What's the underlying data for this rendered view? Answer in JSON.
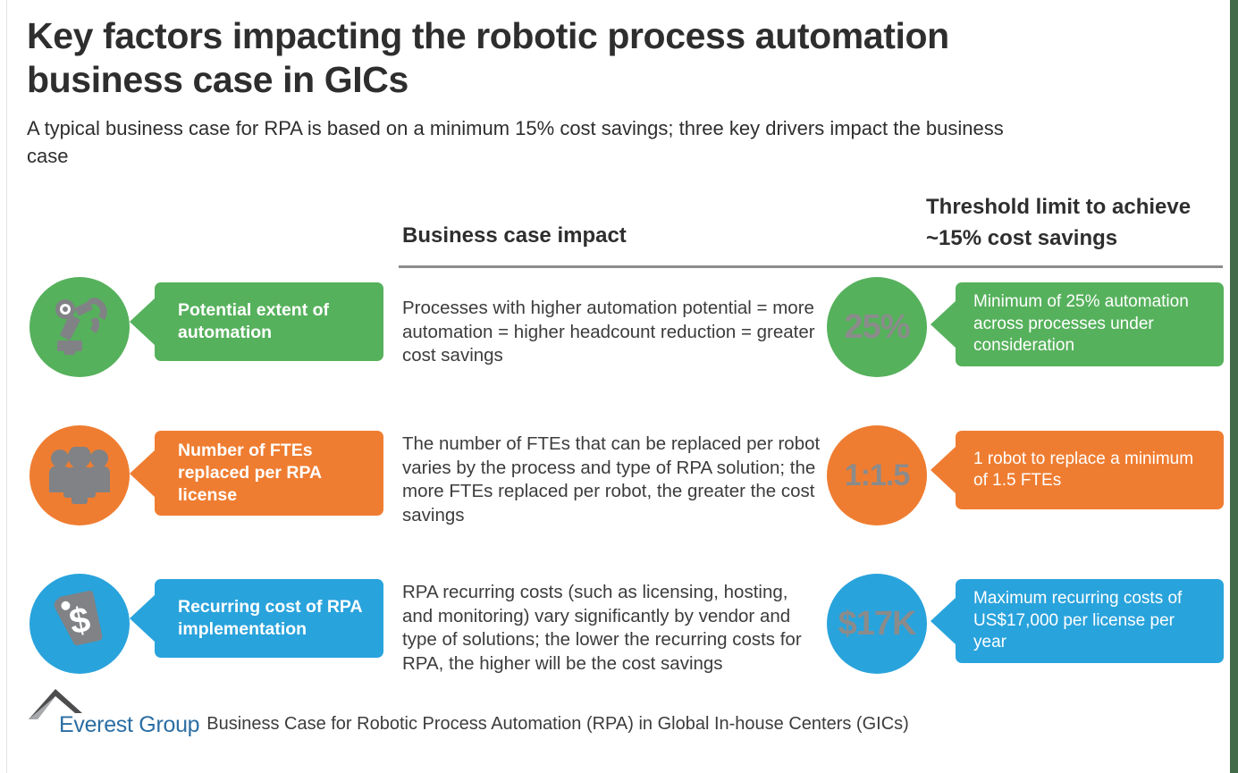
{
  "colors": {
    "green": "#56b15c",
    "orange": "#ef7d31",
    "blue": "#29a3dc",
    "icon_gray": "#808285",
    "value_gray": "#8b8b8b",
    "edge_green": "#426b4a",
    "rule_gray": "#8c8c8c",
    "logo_blue": "#2b6ea3",
    "logo_mark_gray": "#4d4d4f",
    "text_dark": "#2e2e2e"
  },
  "header": {
    "title": "Key factors impacting the robotic process automation business case in GICs",
    "subtitle": "A typical business case for RPA is based on a minimum 15% cost  savings; three key drivers impact the business case"
  },
  "columns": {
    "impact_header": "Business case impact",
    "threshold_header_line1": "Threshold limit to achieve",
    "threshold_header_line2": "~15% cost savings"
  },
  "rows": [
    {
      "color": "#56b15c",
      "icon": "robot-arm-icon",
      "driver_label": "Potential extent of automation",
      "impact_text": "Processes with higher automation potential = more automation = higher headcount reduction = greater cost savings",
      "value": "25%",
      "threshold_text": "Minimum of 25% automation across processes under consideration"
    },
    {
      "color": "#ef7d31",
      "icon": "people-group-icon",
      "driver_label": "Number of FTEs replaced per RPA license",
      "impact_text": "The number of FTEs that can be replaced per robot varies by the process and type of RPA solution; the more FTEs replaced per robot, the greater the cost savings",
      "value": "1:1.5",
      "threshold_text": "1 robot to replace a minimum of 1.5 FTEs"
    },
    {
      "color": "#29a3dc",
      "icon": "price-tag-dollar-icon",
      "driver_label": "Recurring cost of RPA implementation",
      "impact_text": "RPA recurring costs (such as licensing, hosting, and monitoring) vary significantly by vendor and type of solutions; the lower the recurring costs for RPA, the higher will be the cost savings",
      "value": "$17K",
      "threshold_text": "Maximum recurring costs of US$17,000 per license per year"
    }
  ],
  "footer": {
    "logo_text": "Everest Group",
    "note": "Business Case for Robotic Process Automation (RPA) in Global In-house Centers (GICs)"
  }
}
